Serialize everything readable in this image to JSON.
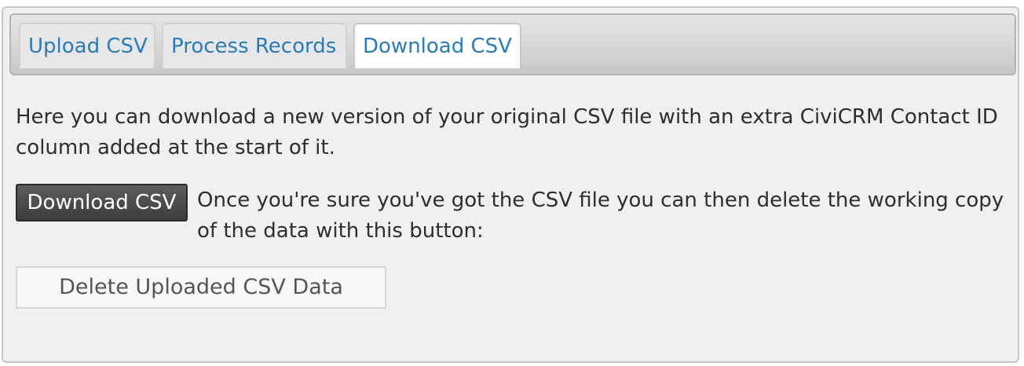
{
  "tabs": [
    {
      "label": "Upload CSV",
      "active": false
    },
    {
      "label": "Process Records",
      "active": false
    },
    {
      "label": "Download CSV",
      "active": true
    }
  ],
  "content": {
    "intro": "Here you can download a new version of your original CSV file with an extra CiviCRM Contact ID column added at the start of it.",
    "download_button": "Download CSV",
    "delete_hint": "Once you're sure you've got the CSV file you can then delete the working copy of the data with this button:",
    "delete_button": "Delete Uploaded CSV Data"
  },
  "colors": {
    "tab_link": "#2b7bb9",
    "panel_bg": "#f0f0f0",
    "download_button_bg": "#4a4a4a"
  }
}
